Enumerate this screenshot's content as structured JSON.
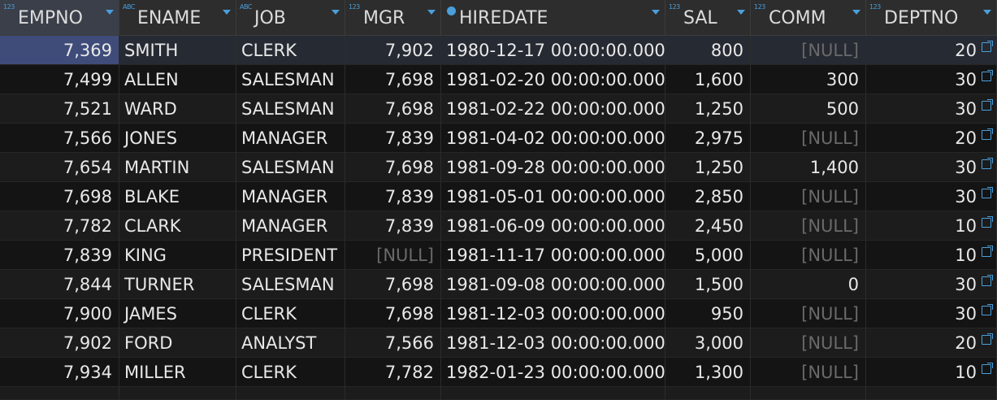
{
  "columns": [
    {
      "name": "EMPNO",
      "type": "123"
    },
    {
      "name": "ENAME",
      "type": "ABC"
    },
    {
      "name": "JOB",
      "type": "ABC"
    },
    {
      "name": "MGR",
      "type": "123"
    },
    {
      "name": "HIREDATE",
      "type": "clock"
    },
    {
      "name": "SAL",
      "type": "123"
    },
    {
      "name": "COMM",
      "type": "123"
    },
    {
      "name": "DEPTNO",
      "type": "123"
    }
  ],
  "rows": [
    {
      "empno": "7,369",
      "ename": "SMITH",
      "job": "CLERK",
      "mgr": "7,902",
      "hiredate": "1980-12-17 00:00:00.000",
      "sal": "800",
      "comm": "[NULL]",
      "deptno": "20"
    },
    {
      "empno": "7,499",
      "ename": "ALLEN",
      "job": "SALESMAN",
      "mgr": "7,698",
      "hiredate": "1981-02-20 00:00:00.000",
      "sal": "1,600",
      "comm": "300",
      "deptno": "30"
    },
    {
      "empno": "7,521",
      "ename": "WARD",
      "job": "SALESMAN",
      "mgr": "7,698",
      "hiredate": "1981-02-22 00:00:00.000",
      "sal": "1,250",
      "comm": "500",
      "deptno": "30"
    },
    {
      "empno": "7,566",
      "ename": "JONES",
      "job": "MANAGER",
      "mgr": "7,839",
      "hiredate": "1981-04-02 00:00:00.000",
      "sal": "2,975",
      "comm": "[NULL]",
      "deptno": "20"
    },
    {
      "empno": "7,654",
      "ename": "MARTIN",
      "job": "SALESMAN",
      "mgr": "7,698",
      "hiredate": "1981-09-28 00:00:00.000",
      "sal": "1,250",
      "comm": "1,400",
      "deptno": "30"
    },
    {
      "empno": "7,698",
      "ename": "BLAKE",
      "job": "MANAGER",
      "mgr": "7,839",
      "hiredate": "1981-05-01 00:00:00.000",
      "sal": "2,850",
      "comm": "[NULL]",
      "deptno": "30"
    },
    {
      "empno": "7,782",
      "ename": "CLARK",
      "job": "MANAGER",
      "mgr": "7,839",
      "hiredate": "1981-06-09 00:00:00.000",
      "sal": "2,450",
      "comm": "[NULL]",
      "deptno": "10"
    },
    {
      "empno": "7,839",
      "ename": "KING",
      "job": "PRESIDENT",
      "mgr": "[NULL]",
      "hiredate": "1981-11-17 00:00:00.000",
      "sal": "5,000",
      "comm": "[NULL]",
      "deptno": "10"
    },
    {
      "empno": "7,844",
      "ename": "TURNER",
      "job": "SALESMAN",
      "mgr": "7,698",
      "hiredate": "1981-09-08 00:00:00.000",
      "sal": "1,500",
      "comm": "0",
      "deptno": "30"
    },
    {
      "empno": "7,900",
      "ename": "JAMES",
      "job": "CLERK",
      "mgr": "7,698",
      "hiredate": "1981-12-03 00:00:00.000",
      "sal": "950",
      "comm": "[NULL]",
      "deptno": "30"
    },
    {
      "empno": "7,902",
      "ename": "FORD",
      "job": "ANALYST",
      "mgr": "7,566",
      "hiredate": "1981-12-03 00:00:00.000",
      "sal": "3,000",
      "comm": "[NULL]",
      "deptno": "20"
    },
    {
      "empno": "7,934",
      "ename": "MILLER",
      "job": "CLERK",
      "mgr": "7,782",
      "hiredate": "1982-01-23 00:00:00.000",
      "sal": "1,300",
      "comm": "[NULL]",
      "deptno": "10"
    }
  ]
}
